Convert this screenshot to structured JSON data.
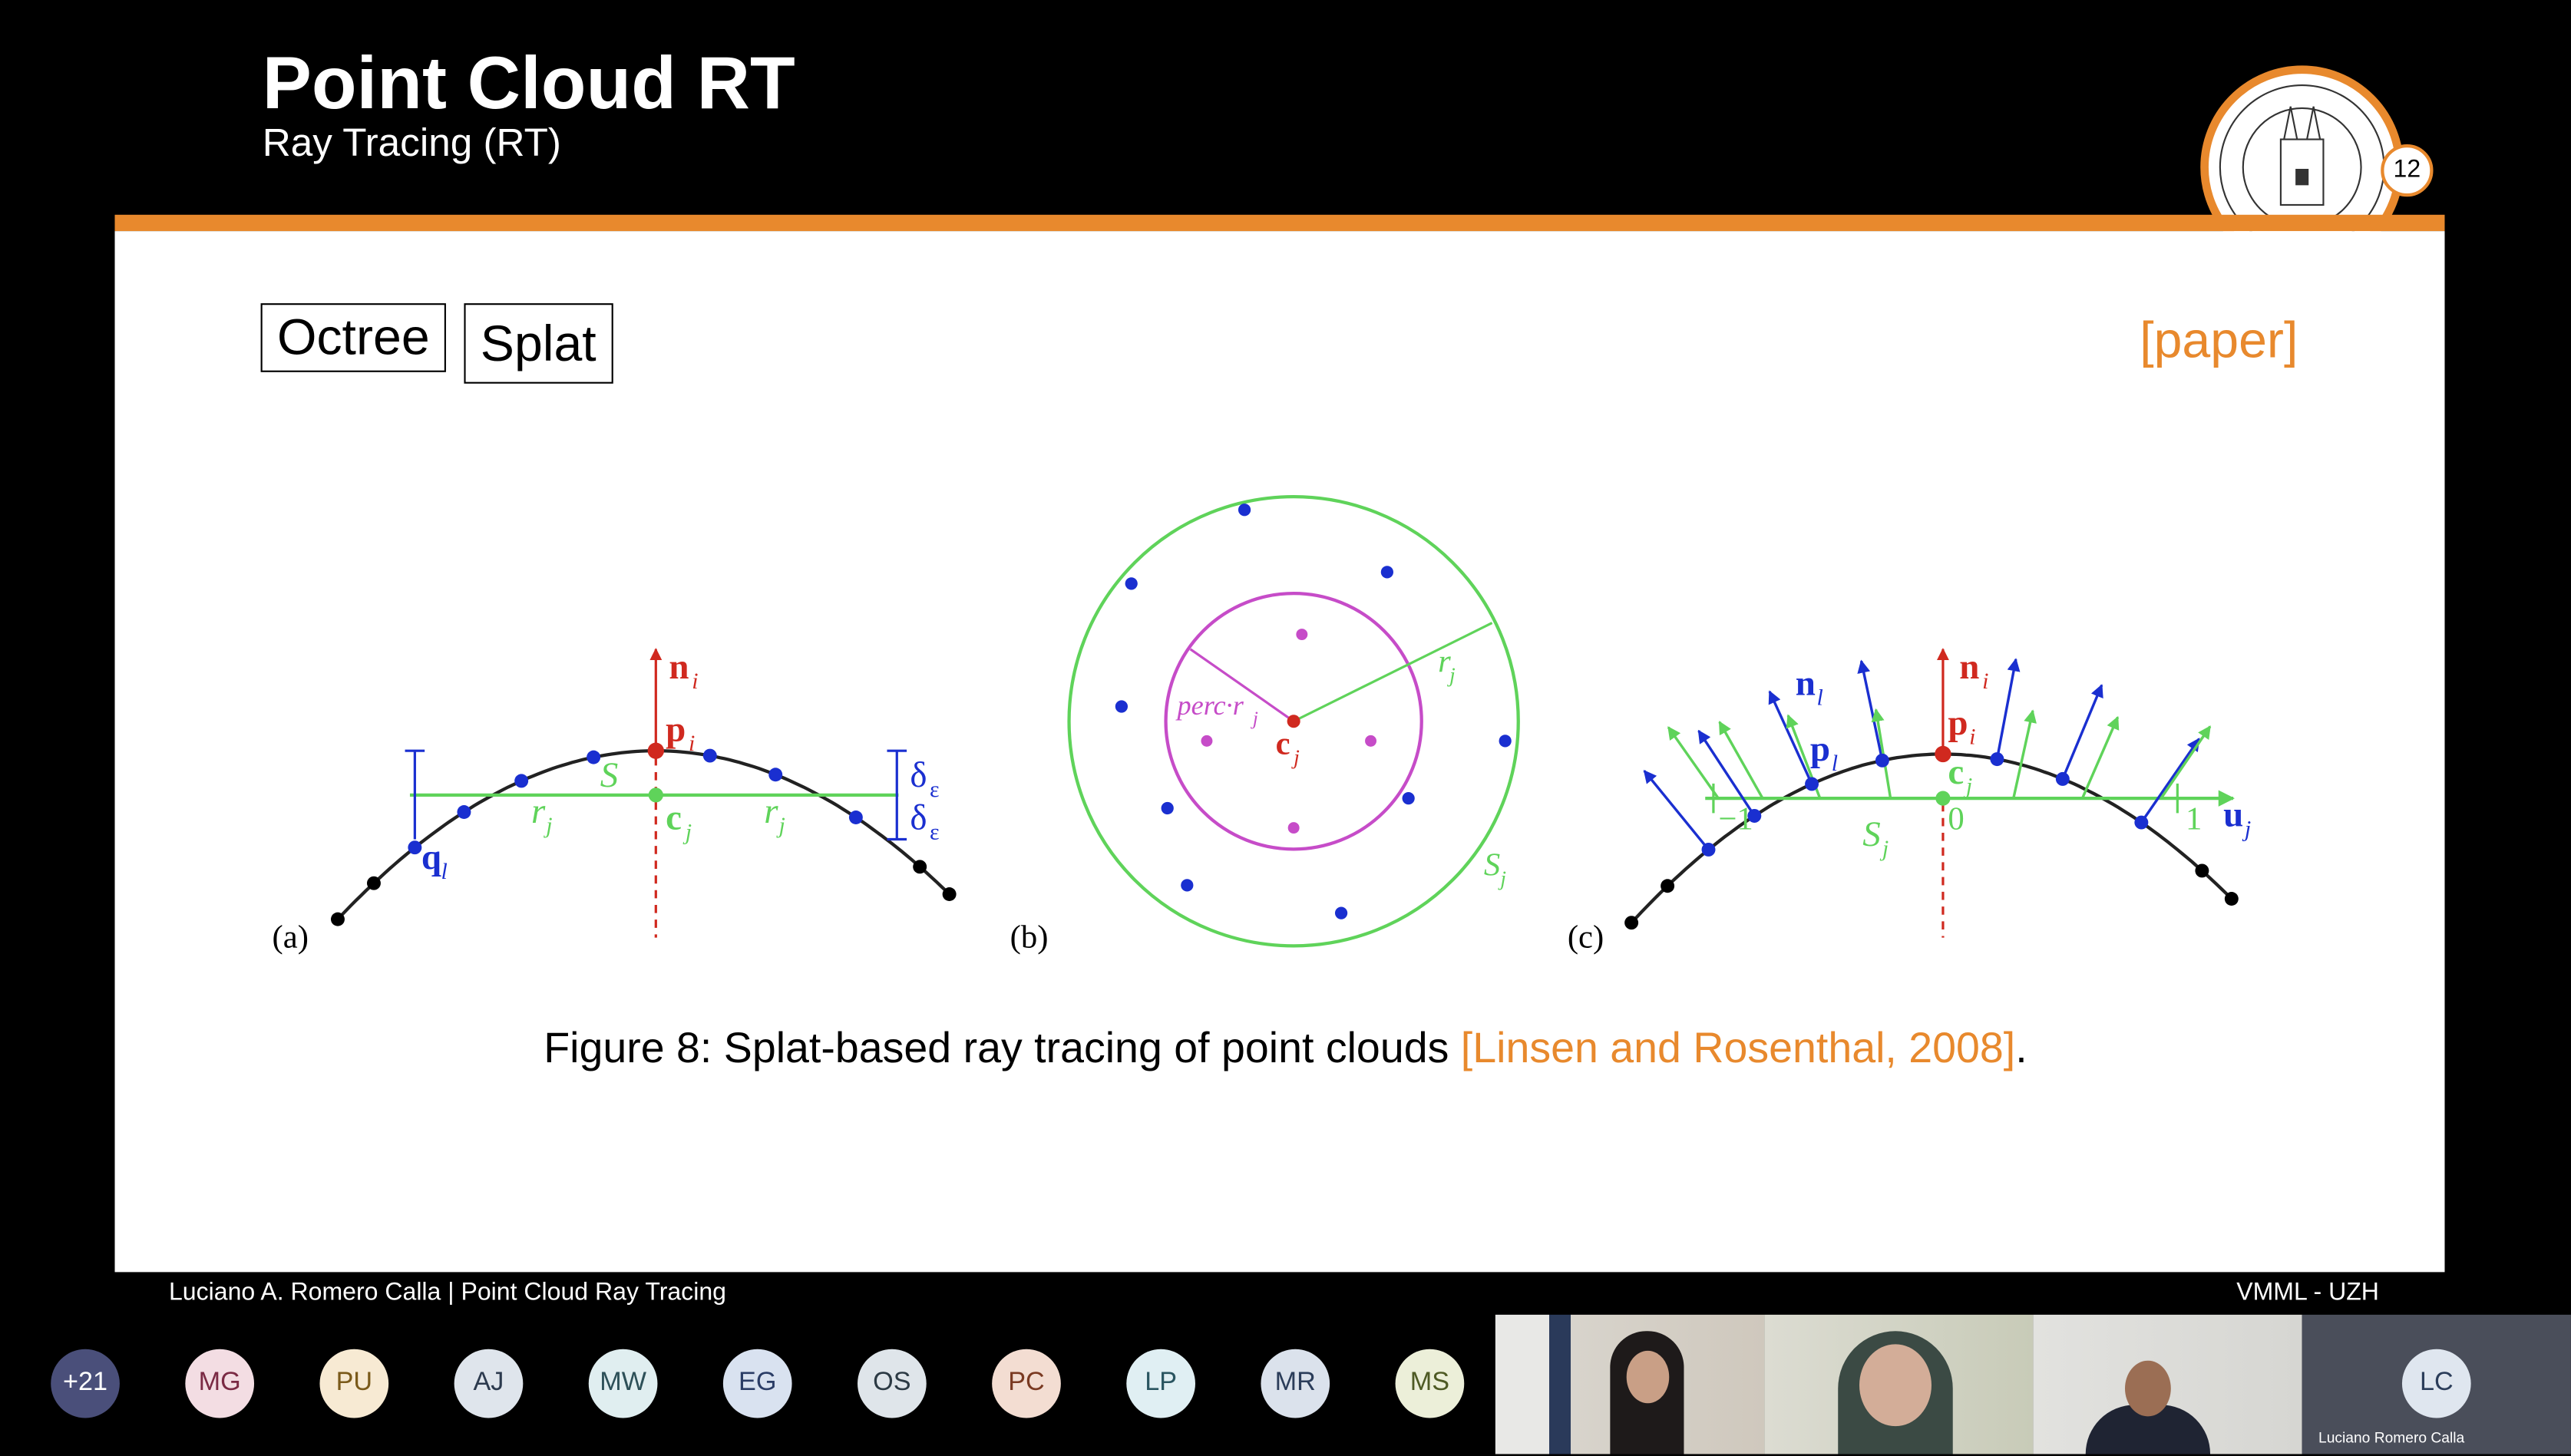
{
  "slide": {
    "title": "Point Cloud RT",
    "subtitle": "Ray Tracing (RT)",
    "page_number": "12",
    "tags": [
      "Octree",
      "Splat"
    ],
    "paper_link": "[paper]",
    "caption_text": "Figure 8: Splat-based ray tracing of point clouds ",
    "caption_cite": "[Linsen and Rosenthal, 2008]",
    "caption_end": ".",
    "figure_labels": {
      "a": "(a)",
      "b": "(b)",
      "c": "(c)",
      "n_i": "n",
      "p_i": "p",
      "c_j": "c",
      "q_l": "q",
      "S_j": "S",
      "r_j": "r",
      "delta": "δ",
      "sub_i": "i",
      "sub_j": "j",
      "sub_l": "l",
      "sub_eps": "ε",
      "perc": "perc·r",
      "n_l": "n",
      "p_l": "p",
      "u_j": "u",
      "minus_one": "−1",
      "zero": "0",
      "one": "1"
    },
    "colors": {
      "accent": "#e8892d",
      "green": "#5fd35a",
      "blue": "#1a2fd0",
      "red": "#d0291f",
      "magenta": "#c64cc8"
    }
  },
  "footer": {
    "left": "Luciano A. Romero Calla | Point Cloud Ray Tracing",
    "right": "VMML - UZH"
  },
  "participants": [
    {
      "initials": "+21",
      "bg": "#4a4f7a",
      "fg": "#ffffff"
    },
    {
      "initials": "MG",
      "bg": "#f3dde3",
      "fg": "#7a2a44"
    },
    {
      "initials": "PU",
      "bg": "#f7ead3",
      "fg": "#7a5a1a"
    },
    {
      "initials": "AJ",
      "bg": "#dfe5ec",
      "fg": "#2c3a4e"
    },
    {
      "initials": "MW",
      "bg": "#e0eef0",
      "fg": "#2d5058"
    },
    {
      "initials": "EG",
      "bg": "#d9e2f0",
      "fg": "#2b3d66"
    },
    {
      "initials": "OS",
      "bg": "#dfe5ea",
      "fg": "#2c3a44"
    },
    {
      "initials": "PC",
      "bg": "#f3ddd2",
      "fg": "#7a3a22"
    },
    {
      "initials": "LP",
      "bg": "#e0eff3",
      "fg": "#2a5560"
    },
    {
      "initials": "MR",
      "bg": "#dbe2ec",
      "fg": "#2b3d5a"
    },
    {
      "initials": "MS",
      "bg": "#ecefd9",
      "fg": "#4e5a24"
    }
  ],
  "self_view": {
    "initials": "LC",
    "name": "Luciano Romero Calla"
  }
}
